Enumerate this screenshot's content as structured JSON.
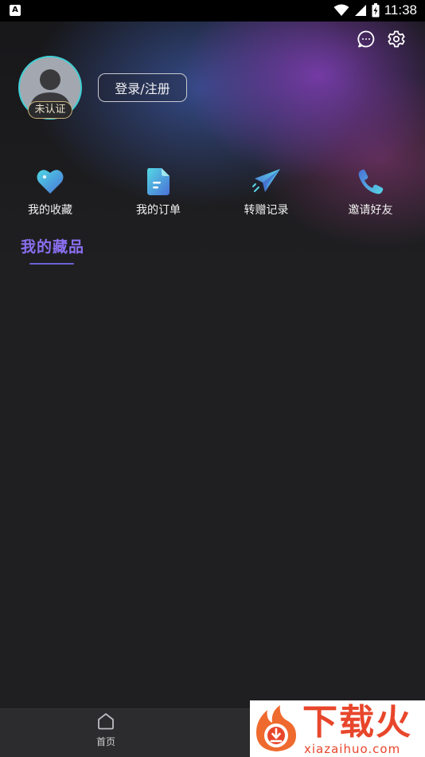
{
  "status_bar": {
    "time": "11:38",
    "app_icon_glyph": "A",
    "icons": [
      "wifi-icon",
      "cell-signal-icon",
      "battery-charging-icon"
    ]
  },
  "header": {
    "actions": [
      "message-icon",
      "settings-icon"
    ]
  },
  "profile": {
    "badge": "未认证",
    "login_label": "登录/注册"
  },
  "quick_menu": [
    {
      "label": "我的收藏",
      "icon": "heart-tag-icon"
    },
    {
      "label": "我的订单",
      "icon": "document-icon"
    },
    {
      "label": "转赠记录",
      "icon": "paper-plane-icon"
    },
    {
      "label": "邀请好友",
      "icon": "phone-icon"
    }
  ],
  "section": {
    "title": "我的藏品"
  },
  "bottom_nav": {
    "home_label": "首页"
  },
  "watermark": {
    "text": "下载火",
    "url": "xiazaihuo.com"
  },
  "colors": {
    "accent_purple": "#8a6ff0",
    "avatar_ring": "#3fd1d6",
    "badge_border": "#c9b27a",
    "watermark_red": "#e8462b"
  }
}
